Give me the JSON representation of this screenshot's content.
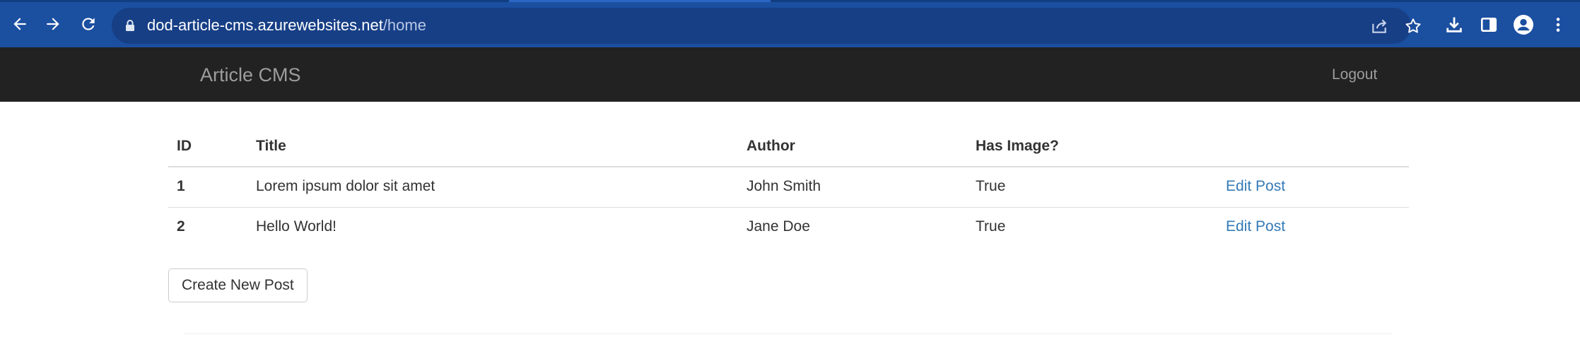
{
  "browser": {
    "url_host": "dod-article-cms.azurewebsites.net",
    "url_path": "/home"
  },
  "navbar": {
    "brand": "Article CMS",
    "logout": "Logout"
  },
  "table": {
    "headers": [
      "ID",
      "Title",
      "Author",
      "Has Image?",
      ""
    ],
    "rows": [
      {
        "id": "1",
        "title": "Lorem ipsum dolor sit amet",
        "author": "John Smith",
        "has_image": "True",
        "action": "Edit Post"
      },
      {
        "id": "2",
        "title": "Hello World!",
        "author": "Jane Doe",
        "has_image": "True",
        "action": "Edit Post"
      }
    ]
  },
  "actions": {
    "create": "Create New Post"
  },
  "colors": {
    "chrome": "#1b4fa0",
    "omnibox": "#173f86",
    "navbar": "#222222",
    "link": "#337ab7"
  }
}
